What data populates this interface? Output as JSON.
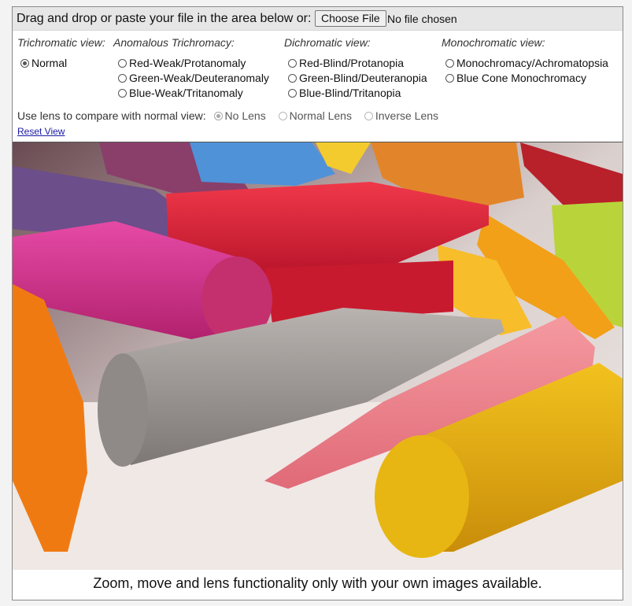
{
  "upload": {
    "prompt": "Drag and drop or paste your file in the area below or:",
    "button_label": "Choose File",
    "file_status": "No file chosen"
  },
  "views": [
    {
      "heading": "Trichromatic view:",
      "options": [
        "Normal"
      ]
    },
    {
      "heading": "Anomalous Trichromacy:",
      "options": [
        "Red-Weak/Protanomaly",
        "Green-Weak/Deuteranomaly",
        "Blue-Weak/Tritanomaly"
      ]
    },
    {
      "heading": "Dichromatic view:",
      "options": [
        "Red-Blind/Protanopia",
        "Green-Blind/Deuteranopia",
        "Blue-Blind/Tritanopia"
      ]
    },
    {
      "heading": "Monochromatic view:",
      "options": [
        "Monochromacy/Achromatopsia",
        "Blue Cone Monochromacy"
      ]
    }
  ],
  "selected_view": "Normal",
  "lens": {
    "label": "Use lens to compare with normal view:",
    "options": [
      "No Lens",
      "Normal Lens",
      "Inverse Lens"
    ],
    "selected": "No Lens"
  },
  "reset_label": "Reset View",
  "caption": "Zoom, move and lens functionality only with your own images available.",
  "colors": {
    "frame_border": "#8a8a8a",
    "upload_bar": "#e6e6e6",
    "link": "#1a1aa6"
  }
}
